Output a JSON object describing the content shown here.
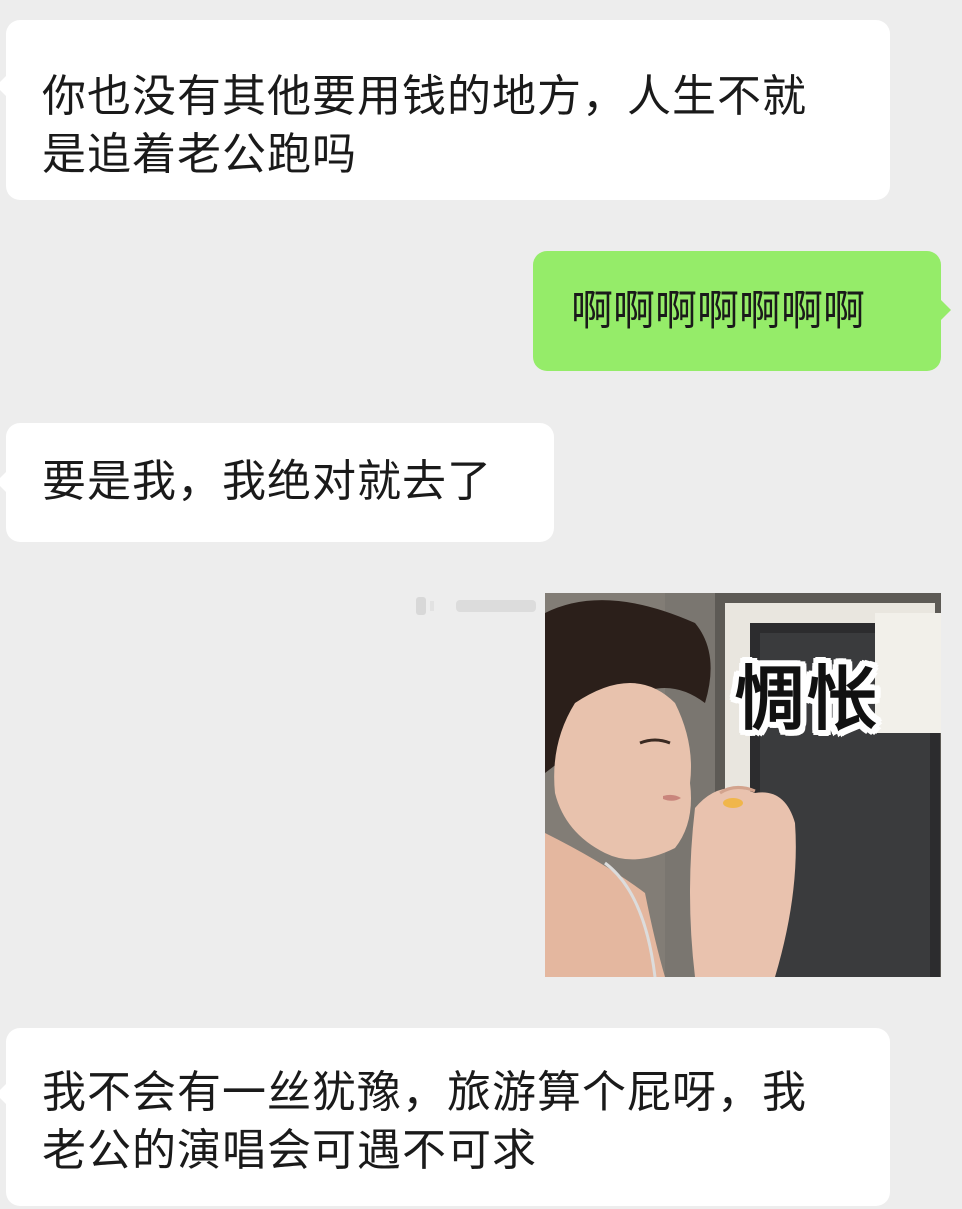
{
  "messages": [
    {
      "id": "msg1",
      "side": "incoming",
      "lines": [
        "你也没有其他要用钱的地方，人生不就",
        "是追着老公跑吗"
      ]
    },
    {
      "id": "msg2",
      "side": "outgoing",
      "text": "啊啊啊啊啊啊啊"
    },
    {
      "id": "msg3",
      "side": "incoming",
      "text": "要是我，我绝对就去了"
    },
    {
      "id": "msg4",
      "side": "outgoing",
      "type": "sticker",
      "caption": "惆怅"
    },
    {
      "id": "msg5",
      "side": "incoming",
      "lines": [
        "我不会有一丝犹豫，旅游算个屁呀，我",
        "老公的演唱会可遇不可求"
      ]
    }
  ],
  "colors": {
    "background": "#ededed",
    "incoming_bubble": "#ffffff",
    "outgoing_bubble": "#95ec69"
  }
}
